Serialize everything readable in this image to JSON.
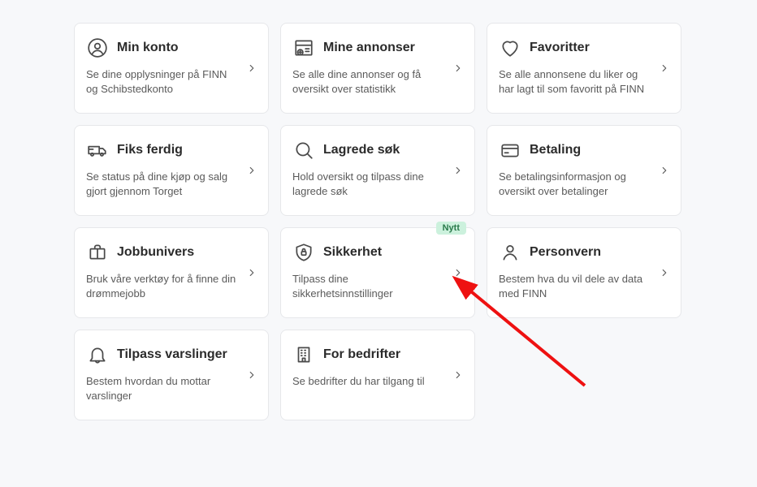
{
  "cards": [
    {
      "id": "account",
      "title": "Min konto",
      "desc": "Se dine opplysninger på FINN og Schibstedkonto",
      "icon": "user-circle"
    },
    {
      "id": "ads",
      "title": "Mine annonser",
      "desc": "Se alle dine annonser og få oversikt over statistikk",
      "icon": "ad-list"
    },
    {
      "id": "favorites",
      "title": "Favoritter",
      "desc": "Se alle annonsene du liker og har lagt til som favoritt på FINN",
      "icon": "heart"
    },
    {
      "id": "fiks-ferdig",
      "title": "Fiks ferdig",
      "desc": "Se status på dine kjøp og salg gjort gjennom Torget",
      "icon": "truck"
    },
    {
      "id": "saved-searches",
      "title": "Lagrede søk",
      "desc": "Hold oversikt og tilpass dine lagrede søk",
      "icon": "search"
    },
    {
      "id": "payment",
      "title": "Betaling",
      "desc": "Se betalingsinformasjon og oversikt over betalinger",
      "icon": "card"
    },
    {
      "id": "job-universe",
      "title": "Jobbunivers",
      "desc": "Bruk våre verktøy for å finne din drømmejobb",
      "icon": "briefcase"
    },
    {
      "id": "security",
      "title": "Sikkerhet",
      "desc": "Tilpass dine sikkerhetsinnstillinger",
      "icon": "shield-lock",
      "badge": "Nytt"
    },
    {
      "id": "privacy",
      "title": "Personvern",
      "desc": "Bestem hva du vil dele av data med FINN",
      "icon": "person"
    },
    {
      "id": "notifications",
      "title": "Tilpass varslinger",
      "desc": "Bestem hvordan du mottar varslinger",
      "icon": "bell"
    },
    {
      "id": "business",
      "title": "For bedrifter",
      "desc": "Se bedrifter du har tilgang til",
      "icon": "building"
    }
  ]
}
